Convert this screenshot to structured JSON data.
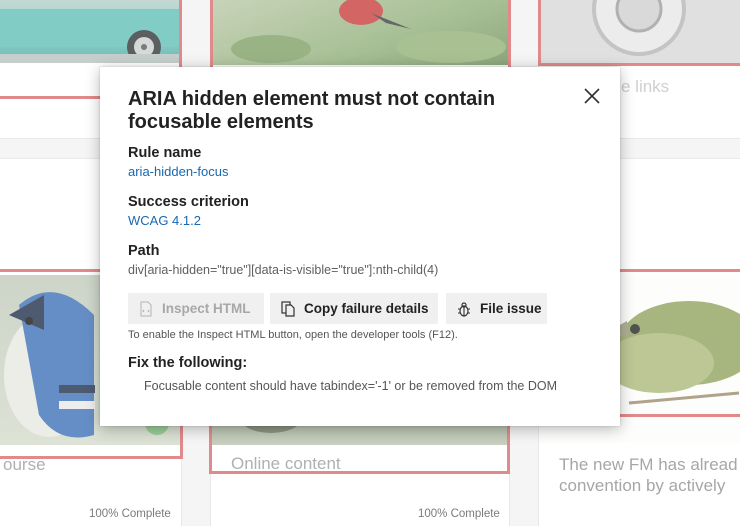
{
  "background": {
    "cards": [
      {
        "text": "",
        "progress": ""
      },
      {
        "text": "",
        "progress": ""
      },
      {
        "text": "e links",
        "progress": ""
      },
      {
        "text": "ourse",
        "progress": "100% Complete"
      },
      {
        "text": "Online content",
        "progress": "100% Complete"
      },
      {
        "text": "The new FM has alread\nconvention by actively",
        "progress": ""
      }
    ],
    "highlight_color": "#d9696b"
  },
  "dialog": {
    "title": "ARIA hidden element must not contain focusable elements",
    "close_icon": "close-icon",
    "rule_name_label": "Rule name",
    "rule_name_value": "aria-hidden-focus",
    "success_criterion_label": "Success criterion",
    "success_criterion_value": "WCAG 4.1.2",
    "path_label": "Path",
    "path_value": "div[aria-hidden=\"true\"][data-is-visible=\"true\"]:nth-child(4)",
    "buttons": {
      "inspect_html": {
        "label": "Inspect HTML",
        "icon": "inspect-html-icon",
        "enabled": false
      },
      "copy_failure": {
        "label": "Copy failure details",
        "icon": "copy-icon",
        "enabled": true
      },
      "file_issue": {
        "label": "File issue",
        "icon": "bug-icon",
        "enabled": true
      }
    },
    "inspect_hint": "To enable the Inspect HTML button, open the developer tools (F12).",
    "fix_label": "Fix the following:",
    "fix_text": "Focusable content should have tabindex='-1' or be removed from the DOM",
    "link_color": "#1868b0"
  }
}
